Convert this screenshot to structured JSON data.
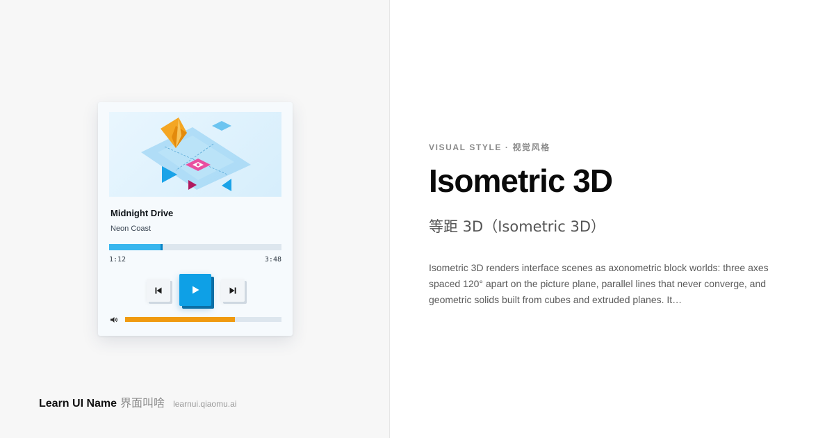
{
  "player": {
    "track_title": "Midnight Drive",
    "artist": "Neon Coast",
    "time_current": "1:12",
    "time_total": "3:48",
    "progress_fraction": 0.31,
    "volume_fraction": 0.7,
    "accent_color": "#0ea0e6",
    "volume_color": "#f09a10",
    "icons": {
      "previous": "skip-previous-icon",
      "play": "play-icon",
      "next": "skip-next-icon",
      "volume": "volume-icon"
    }
  },
  "content": {
    "category": "VISUAL STYLE · 视觉风格",
    "title": "Isometric 3D",
    "subtitle": "等距 3D（Isometric 3D）",
    "description": "Isometric 3D renders interface scenes as axonometric block worlds: three axes spaced 120° apart on the picture plane, parallel lines that never converge, and geometric solids built from cubes and extruded planes. It…"
  },
  "footer": {
    "brand_name": "Learn UI Name",
    "brand_cn": "界面叫啥",
    "url": "learnui.qiaomu.ai"
  }
}
